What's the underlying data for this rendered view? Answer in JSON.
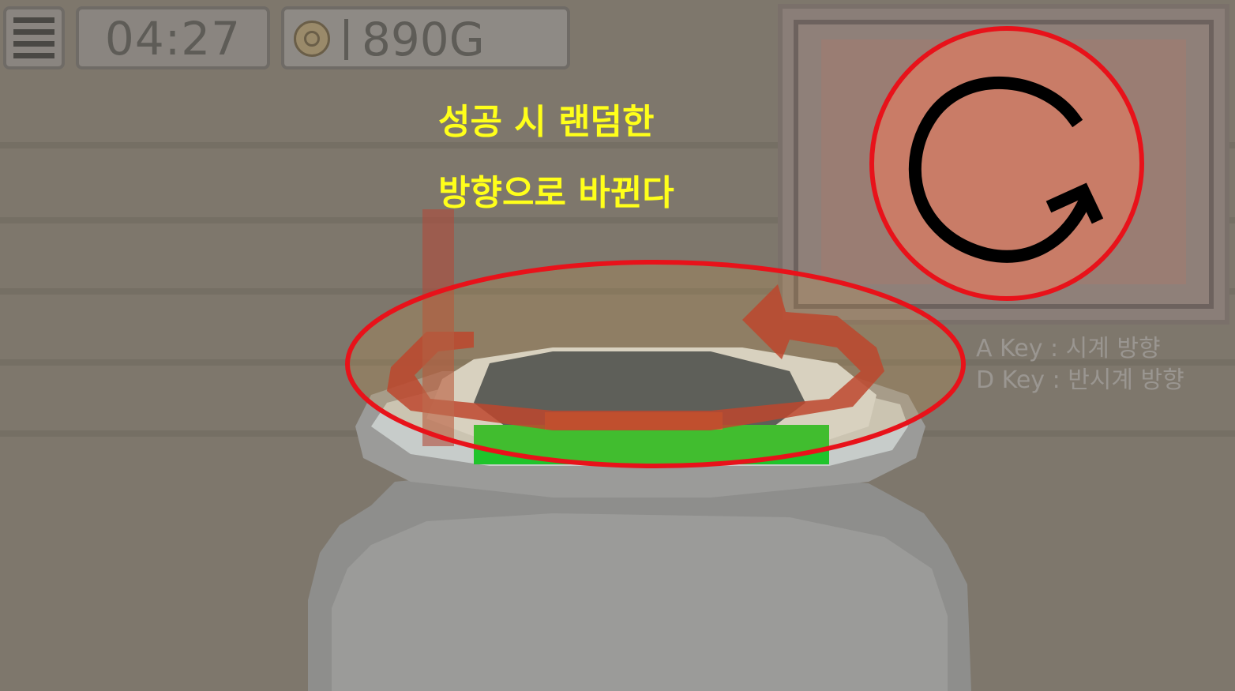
{
  "hud": {
    "menu_icon": "hamburger-menu-icon",
    "timer": "04:27",
    "coin_icon": "coin-icon",
    "gold": "890G"
  },
  "caption": {
    "line1": "성공 시 랜덤한",
    "line2": "방향으로 바뀐다"
  },
  "direction_indicator": {
    "icon": "clockwise-arrow-icon"
  },
  "controls": {
    "a_key": "A Key : 시계 방향",
    "d_key": "D Key : 반시계 방향"
  },
  "colors": {
    "highlight_ring": "#e8121a",
    "caption_text": "#ffff1a",
    "liquid": "#1fc42b",
    "indicator_fill": "#c97c67"
  }
}
